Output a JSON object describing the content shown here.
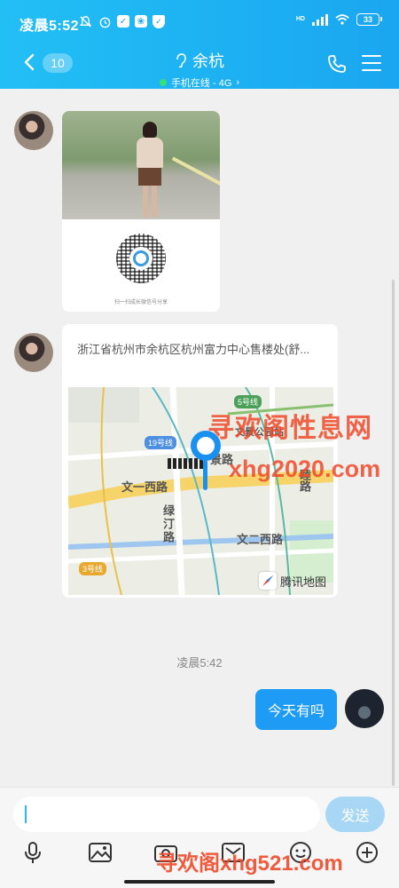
{
  "status_bar": {
    "time": "凌晨5:52",
    "network": "HD",
    "battery": "33"
  },
  "header": {
    "unread_count": "10",
    "contact_name": "余杭",
    "status_text": "手机在线 - 4G",
    "status_chevron": "›"
  },
  "messages": {
    "qr_caption": "扫一扫成长微信号分享",
    "location": {
      "address": "浙江省杭州市余杭区杭州富力中心售楼处(舒...",
      "map_labels": {
        "road_1": "文一西路",
        "road_2": "绿汀路",
        "road_3": "文二西路",
        "road_4": "景路",
        "road_5": "睦路",
        "line_5": "5号线",
        "line_19": "19号线",
        "line_3": "3号线",
        "station": "文景公园站"
      },
      "provider": "腾讯地图"
    },
    "timestamp": "凌晨5:42",
    "outgoing_text": "今天有吗"
  },
  "input_bar": {
    "placeholder": "",
    "send_label": "发送"
  },
  "tools": [
    "mic-icon",
    "image-icon",
    "camera-icon",
    "photo-album-icon",
    "emoji-icon",
    "plus-icon"
  ],
  "watermarks": {
    "line1": "寻欢阁性息网",
    "line2": "xhg2020.com",
    "line3": "寻欢阁xhg521.com"
  },
  "colors": {
    "header": "#1aa6f0",
    "bubble_out": "#1d9bf5",
    "send_disabled": "#a8d6f5",
    "online_dot": "#36e07c"
  }
}
